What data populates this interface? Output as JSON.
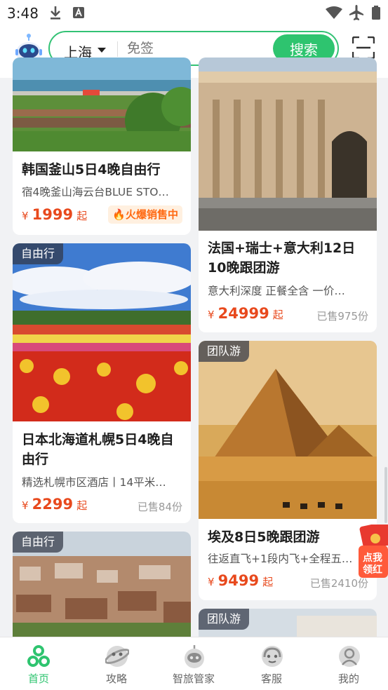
{
  "status_bar": {
    "time": "3:48",
    "icons": [
      "download-icon",
      "font-icon",
      "wifi-icon",
      "airplane-icon",
      "battery-icon"
    ]
  },
  "header": {
    "city": "上海",
    "search_placeholder": "免签",
    "search_button": "搜索",
    "assistant_icon": "robot-icon",
    "scan_icon": "scan-icon"
  },
  "products": [
    {
      "title": "韩国釜山5日4晚自由行",
      "subtitle": "宿4晚釜山海云台BLUE STO…",
      "currency": "¥",
      "price": "1999",
      "price_suffix": "起",
      "badge": "火爆销售中"
    },
    {
      "title": "法国+瑞士+意大利12日10晚跟团游",
      "subtitle": "意大利深度 正餐全含 一价…",
      "currency": "¥",
      "price": "24999",
      "price_suffix": "起",
      "sold": "已售975份"
    },
    {
      "tag": "自由行",
      "title": "日本北海道札幌5日4晚自由行",
      "subtitle": "精选札幌市区酒店丨14平米…",
      "currency": "¥",
      "price": "2299",
      "price_suffix": "起",
      "sold": "已售84份"
    },
    {
      "tag": "团队游",
      "title": "埃及8日5晚跟团游",
      "subtitle": "往返直飞+1段内飞+全程五…",
      "currency": "¥",
      "price": "9499",
      "price_suffix": "起",
      "sold": "已售2410份"
    },
    {
      "tag": "自由行"
    },
    {
      "tag": "团队游"
    }
  ],
  "floating_promo": {
    "line1": "点我",
    "line2": "领红"
  },
  "tab_bar": {
    "items": [
      {
        "label": "首页",
        "icon": "home-icon",
        "active": true
      },
      {
        "label": "攻略",
        "icon": "guide-icon",
        "active": false
      },
      {
        "label": "智旅管家",
        "icon": "butler-icon",
        "active": false
      },
      {
        "label": "客服",
        "icon": "service-icon",
        "active": false
      },
      {
        "label": "我的",
        "icon": "profile-icon",
        "active": false
      }
    ]
  },
  "colors": {
    "accent": "#2ec46f",
    "price": "#e8491d",
    "hot_badge": "#ff6a13"
  }
}
